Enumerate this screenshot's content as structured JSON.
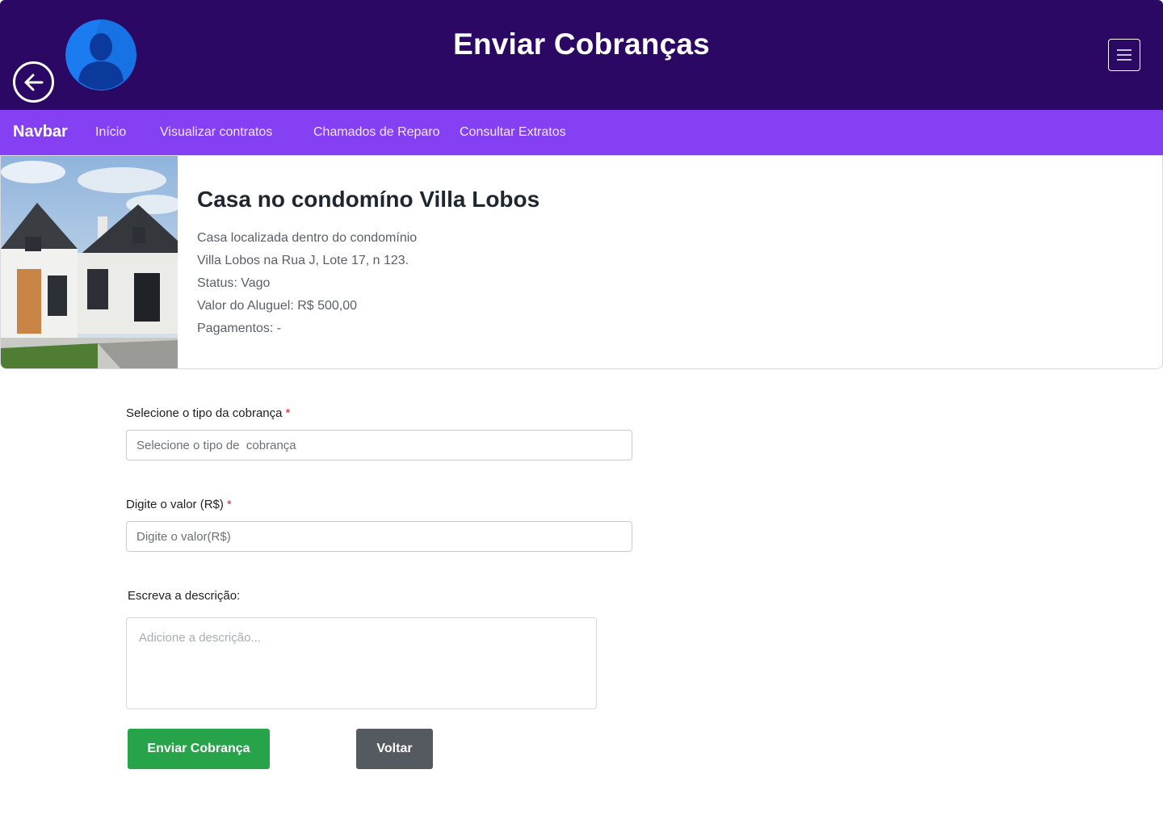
{
  "header": {
    "title": "Enviar Cobranças",
    "back_icon": "arrow-left-icon",
    "avatar_icon": "user-avatar-icon",
    "menu_icon": "hamburger-menu-icon",
    "background_color": "#2a0863"
  },
  "navbar": {
    "brand": "Navbar",
    "links": [
      "Início",
      "Visualizar contratos",
      "Chamados de Reparo",
      "Consultar Extratos"
    ],
    "background_color": "#8440f2"
  },
  "property": {
    "title": "Casa no condomíno Villa Lobos",
    "description_line1": "Casa localizada dentro do condomínio",
    "description_line2": "Villa Lobos na Rua J, Lote 17, n 123.",
    "status": "Status: Vago",
    "rent": "Valor do Aluguel: R$ 500,00",
    "payments": "Pagamentos: -"
  },
  "form": {
    "type_label": "Selecione o tipo da cobrança",
    "type_placeholder": "Selecione o tipo de  cobrança",
    "value_label": "Digite o valor (R$)",
    "value_placeholder": "Digite o valor(R$)",
    "required_mark": "*",
    "description_label": "Escreva a descrição:",
    "description_placeholder": "Adicione a descrição...",
    "submit_label": "Enviar Cobrança",
    "back_label": "Voltar"
  }
}
